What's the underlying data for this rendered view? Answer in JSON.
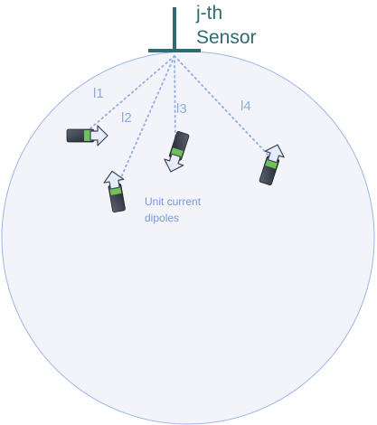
{
  "sensor": {
    "label_line1": "j-th",
    "label_line2": "Sensor"
  },
  "paths": [
    {
      "label": "l1"
    },
    {
      "label": "l2"
    },
    {
      "label": "l3"
    },
    {
      "label": "l4"
    }
  ],
  "caption": {
    "line1": "Unit current",
    "line2": "dipoles"
  },
  "colors": {
    "sensor": "#2e6b72",
    "head_fill": "#f3f4f9",
    "head_stroke": "#9cb6ec",
    "path_lines": "#9bb2e6",
    "dipole_body": "#2d333c",
    "dipole_center": "#6fbf5a",
    "arrow_fill": "#e6ecfa",
    "arrow_stroke": "#3d4656"
  }
}
